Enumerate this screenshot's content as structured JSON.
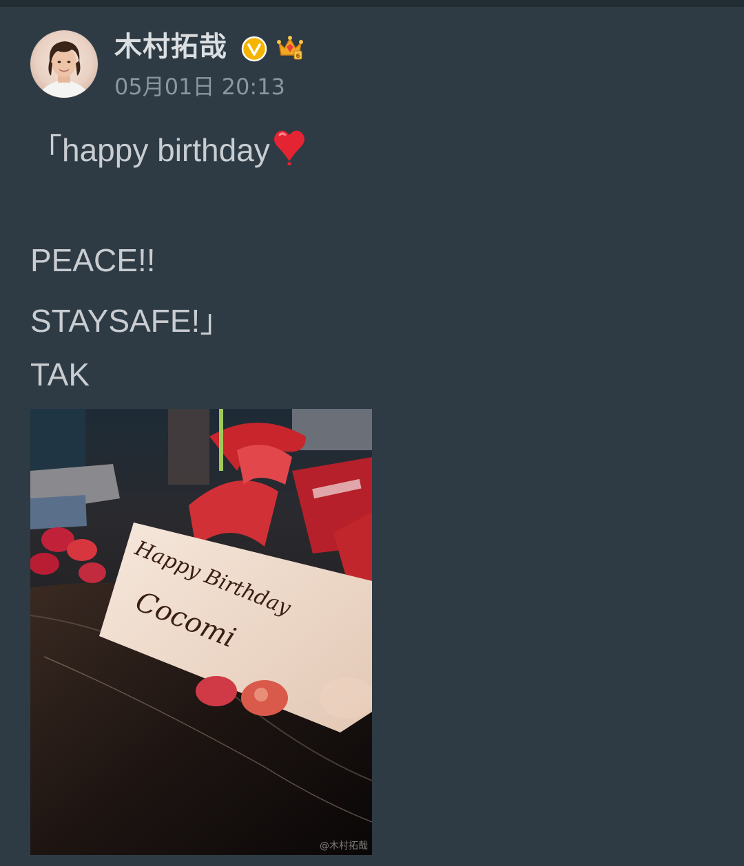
{
  "post": {
    "author": {
      "name": "木村拓哉",
      "verified_icon": "verified-v-icon",
      "vip_icon": "crown-icon"
    },
    "timestamp": "05月01日 20:13",
    "text_lines": [
      "「happy birthday",
      "PEACE!!",
      "STAYSAFE!」",
      "TAK"
    ],
    "emoji": "heart-emoji",
    "image": {
      "cake_plaque_text": [
        "Happy Birthday",
        "Cocomi"
      ],
      "watermark": "@木村拓哉"
    }
  },
  "colors": {
    "background": "#2e3b44",
    "name": "#dcdfe2",
    "time": "#8c969e",
    "text": "#c9cdd1",
    "verified": "#f5b400"
  }
}
